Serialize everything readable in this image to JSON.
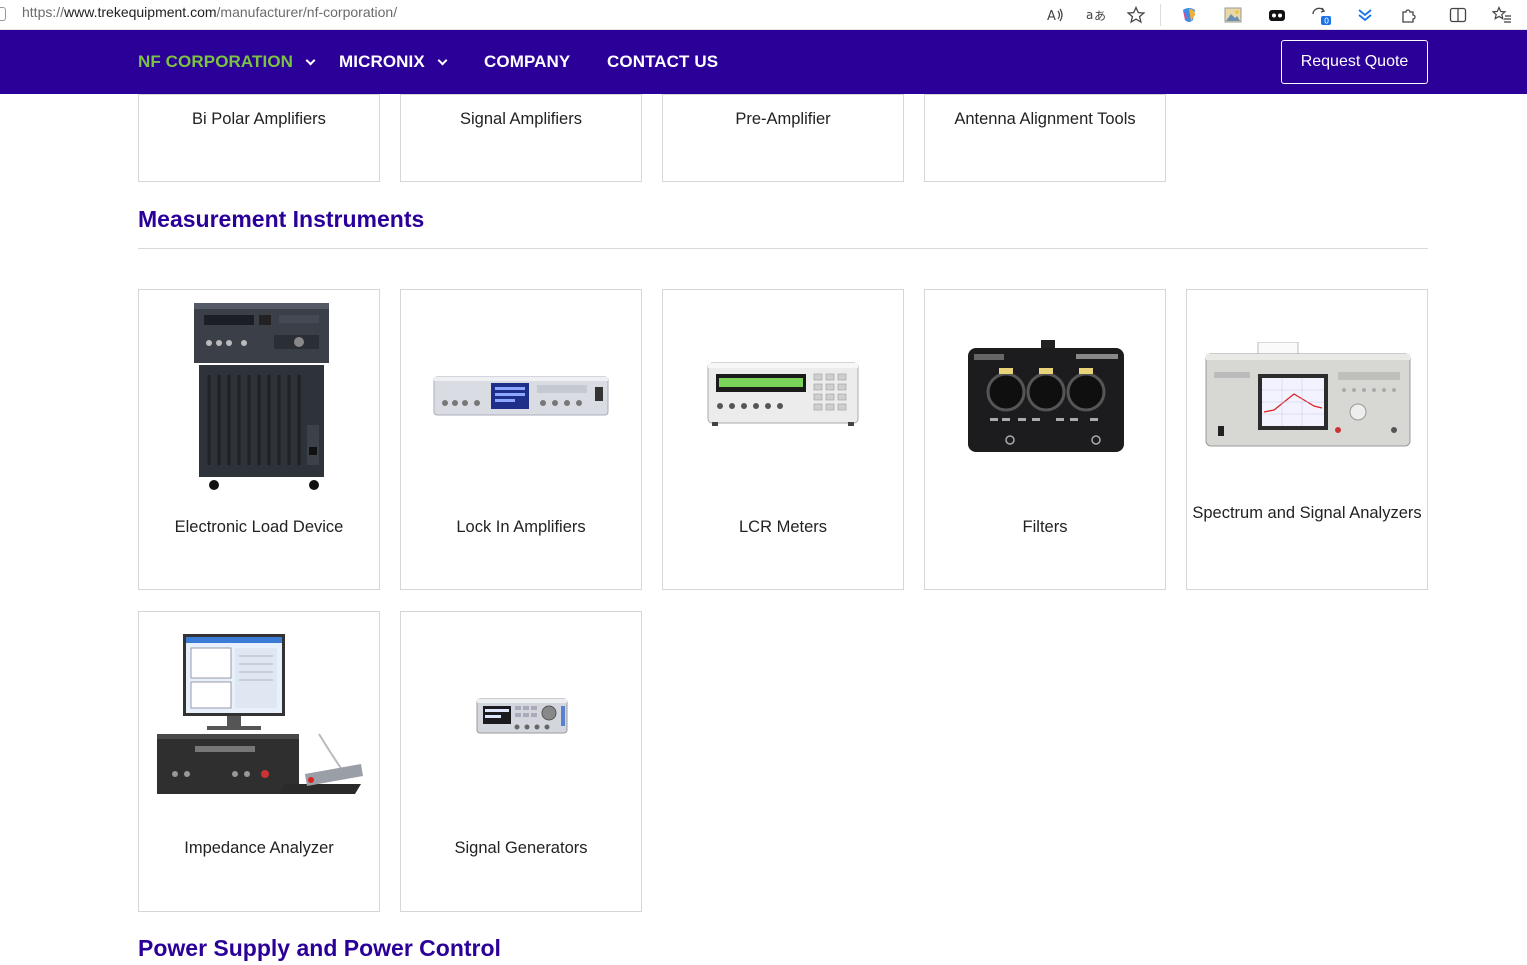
{
  "browser": {
    "url_prefix": "https://",
    "url_host": "www.trekequipment.com",
    "url_path": "/manufacturer/nf-corporation/",
    "icons": [
      "read-aloud-icon",
      "translate-icon",
      "favorite-star-icon",
      "copilot-icon",
      "image-icon",
      "games-icon",
      "sync-icon",
      "download-icon",
      "extensions-icon",
      "split-screen-icon",
      "favorites-list-icon"
    ],
    "sync_badge": "0"
  },
  "nav": {
    "items": [
      {
        "label": "NF CORPORATION",
        "has_dropdown": true,
        "active": true
      },
      {
        "label": "MICRONIX",
        "has_dropdown": true,
        "active": false
      },
      {
        "label": "COMPANY",
        "has_dropdown": false,
        "active": false
      },
      {
        "label": "CONTACT US",
        "has_dropdown": false,
        "active": false
      }
    ],
    "quote_button": "Request Quote",
    "colors": {
      "background": "#2b0099",
      "active": "#7cc242",
      "text": "#ffffff"
    }
  },
  "top_row": [
    {
      "label": "Bi Polar Amplifiers"
    },
    {
      "label": "Signal Amplifiers"
    },
    {
      "label": "Pre-Amplifier"
    },
    {
      "label": "Antenna Alignment Tools"
    }
  ],
  "sections": [
    {
      "title": "Measurement Instruments",
      "products": [
        {
          "label": "Electronic Load Device",
          "image": "electronic-load-device-image"
        },
        {
          "label": "Lock In Amplifiers",
          "image": "lock-in-amplifier-image"
        },
        {
          "label": "LCR Meters",
          "image": "lcr-meter-image"
        },
        {
          "label": "Filters",
          "image": "filter-image"
        },
        {
          "label": "Spectrum and Signal Analyzers",
          "image": "spectrum-analyzer-image"
        },
        {
          "label": "Impedance Analyzer",
          "image": "impedance-analyzer-image"
        },
        {
          "label": "Signal Generators",
          "image": "signal-generator-image"
        }
      ]
    },
    {
      "title": "Power Supply and Power Control"
    }
  ]
}
